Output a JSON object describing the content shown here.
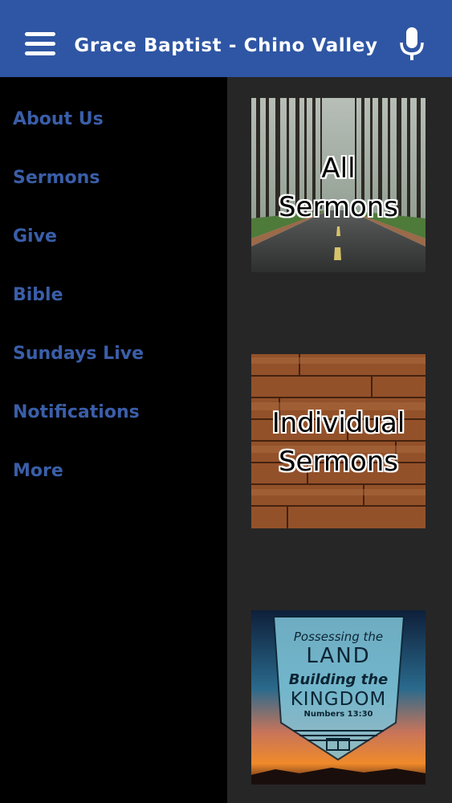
{
  "header": {
    "title": "Grace Baptist - Chino Valley",
    "menu_icon": "hamburger-menu-icon",
    "mic_icon": "microphone-icon",
    "background_color": "#2f56a4"
  },
  "drawer": {
    "items": [
      {
        "label": "About Us"
      },
      {
        "label": "Sermons"
      },
      {
        "label": "Give"
      },
      {
        "label": "Bible"
      },
      {
        "label": "Sundays Live"
      },
      {
        "label": "Notifications"
      },
      {
        "label": "More"
      }
    ],
    "item_color": "#3a5ea8"
  },
  "cards": {
    "all_sermons": {
      "line1": "All",
      "line2": "Sermons"
    },
    "individual_sermons": {
      "line1": "Individual",
      "line2": "Sermons"
    },
    "series": {
      "line1": "Possessing the",
      "line2": "LAND",
      "line3": "Building the",
      "line4": "KINGDOM",
      "line5": "Numbers 13:30"
    }
  }
}
